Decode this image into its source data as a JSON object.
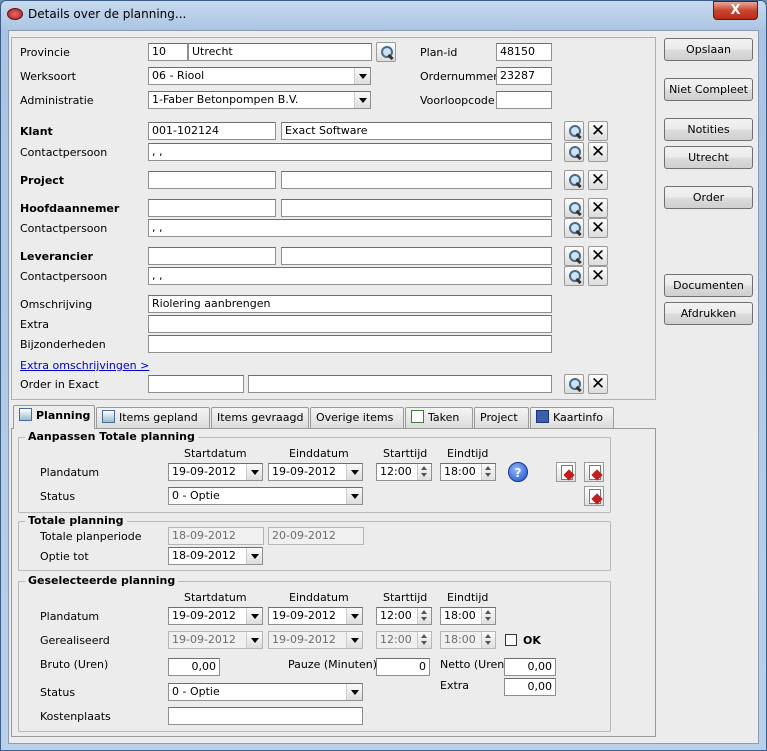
{
  "window": {
    "title": "Details over de planning...",
    "close": "X"
  },
  "header": {
    "provincie": {
      "label": "Provincie",
      "code": "10",
      "name": "Utrecht"
    },
    "werksoort": {
      "label": "Werksoort",
      "value": "06 - Riool"
    },
    "administratie": {
      "label": "Administratie",
      "value": "1-Faber Betonpompen B.V."
    },
    "planid": {
      "label": "Plan-id",
      "value": "48150"
    },
    "ordernummer": {
      "label": "Ordernummer",
      "value": "23287"
    },
    "voorloopcode": {
      "label": "Voorloopcode",
      "value": ""
    }
  },
  "klant": {
    "label": "Klant",
    "code": "001-102124",
    "name": "Exact Software"
  },
  "klant_contact": {
    "label": "Contactpersoon",
    "value": ", ,"
  },
  "project": {
    "label": "Project",
    "code": "",
    "name": ""
  },
  "hoofd": {
    "label": "Hoofdaannemer",
    "code": "",
    "name": ""
  },
  "hoofd_contact": {
    "label": "Contactpersoon",
    "value": ", ,"
  },
  "lev": {
    "label": "Leverancier",
    "code": "",
    "name": ""
  },
  "lev_contact": {
    "label": "Contactpersoon",
    "value": ", ,"
  },
  "omschrijving": {
    "label": "Omschrijving",
    "value": "Riolering aanbrengen"
  },
  "extra": {
    "label": "Extra",
    "value": ""
  },
  "bijzonderheden": {
    "label": "Bijzonderheden",
    "value": ""
  },
  "extra_link": "Extra omschrijvingen >",
  "order_exact": {
    "label": "Order in Exact",
    "code": "",
    "name": ""
  },
  "buttons": {
    "opslaan": "Opslaan",
    "niet_compleet": "Niet Compleet",
    "notities": "Notities",
    "utrecht": "Utrecht",
    "order": "Order",
    "documenten": "Documenten",
    "afdrukken": "Afdrukken"
  },
  "tabs": [
    "Planning",
    "Items gepland",
    "Items gevraagd",
    "Overige items",
    "Taken",
    "Project",
    "Kaartinfo"
  ],
  "aanpassen": {
    "title": "Aanpassen Totale planning",
    "col_start": "Startdatum",
    "col_eind": "Einddatum",
    "col_starttijd": "Starttijd",
    "col_eindtijd": "Eindtijd",
    "plandatum_label": "Plandatum",
    "start": "19-09-2012",
    "eind": "19-09-2012",
    "starttijd": "12:00",
    "eindtijd": "18:00",
    "status_label": "Status",
    "status": "0 - Optie",
    "help": "?"
  },
  "totale": {
    "title": "Totale planning",
    "periode_label": "Totale planperiode",
    "periode_start": "18-09-2012",
    "periode_eind": "20-09-2012",
    "optie_label": "Optie tot",
    "optie": "18-09-2012"
  },
  "gesel": {
    "title": "Geselecteerde planning",
    "col_start": "Startdatum",
    "col_eind": "Einddatum",
    "col_starttijd": "Starttijd",
    "col_eindtijd": "Eindtijd",
    "plandatum_label": "Plandatum",
    "start": "19-09-2012",
    "eind": "19-09-2012",
    "starttijd": "12:00",
    "eindtijd": "18:00",
    "gerealiseerd_label": "Gerealiseerd",
    "g_start": "19-09-2012",
    "g_eind": "19-09-2012",
    "g_starttijd": "12:00",
    "g_eindtijd": "18:00",
    "ok_label": "OK",
    "bruto_label": "Bruto (Uren)",
    "bruto": "0,00",
    "pauze_label": "Pauze (Minuten)",
    "pauze": "0",
    "netto_label": "Netto (Uren)",
    "netto": "0,00",
    "extra_label": "Extra",
    "extra": "0,00",
    "status_label": "Status",
    "status": "0 - Optie",
    "kostenplaats_label": "Kostenplaats",
    "kostenplaats": ""
  }
}
